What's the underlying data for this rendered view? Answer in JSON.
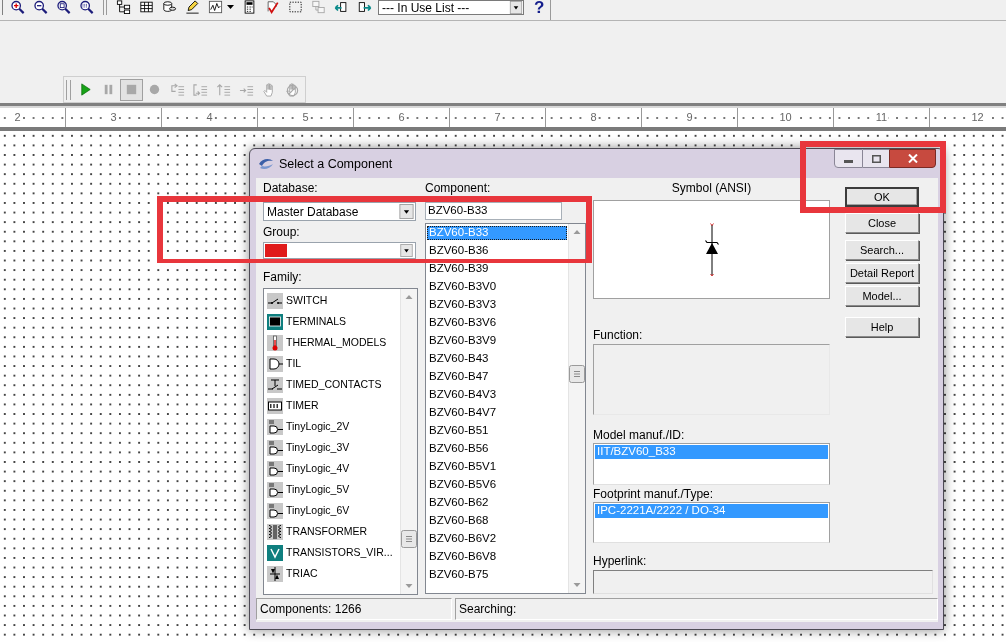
{
  "toolbar": {
    "tool_groups": [
      [
        {
          "kind": "zoomin",
          "disabled": false
        },
        {
          "kind": "zoomout",
          "disabled": false
        },
        {
          "kind": "zoomarea",
          "disabled": false
        },
        {
          "kind": "zoomfit",
          "disabled": false
        }
      ],
      [
        {
          "kind": "tree",
          "disabled": false
        },
        {
          "kind": "grid",
          "disabled": false
        },
        {
          "kind": "database",
          "disabled": false
        },
        {
          "kind": "pencil",
          "disabled": false
        },
        {
          "kind": "chart",
          "disabled": false
        },
        {
          "kind": "calculator",
          "disabled": false
        },
        {
          "kind": "check",
          "disabled": false
        },
        {
          "kind": "marquee",
          "disabled": false
        },
        {
          "kind": "copy",
          "disabled": true
        },
        {
          "kind": "back",
          "disabled": false
        },
        {
          "kind": "forward",
          "disabled": false
        }
      ]
    ],
    "list_dropdown": {
      "value": "--- In Use List ---"
    },
    "help": "?"
  },
  "simulation_toolbar": {
    "tools": [
      {
        "kind": "play",
        "disabled": false,
        "pressed": false
      },
      {
        "kind": "pause",
        "disabled": true,
        "pressed": false
      },
      {
        "kind": "stop",
        "disabled": true,
        "pressed": true
      },
      {
        "kind": "dot",
        "disabled": true,
        "pressed": false
      },
      {
        "kind": "loop",
        "disabled": true,
        "pressed": false
      },
      {
        "kind": "bracket",
        "disabled": true,
        "pressed": false
      },
      {
        "kind": "up",
        "disabled": true,
        "pressed": false
      },
      {
        "kind": "right",
        "disabled": true,
        "pressed": false
      },
      {
        "kind": "hand",
        "disabled": true,
        "pressed": false
      },
      {
        "kind": "handstop",
        "disabled": true,
        "pressed": false
      }
    ]
  },
  "ruler": {
    "marks": [
      "2",
      "3",
      "4",
      "5",
      "6",
      "7",
      "8",
      "9",
      "10",
      "11",
      "12"
    ]
  },
  "dialog": {
    "title": "Select a Component",
    "database": {
      "label": "Database:",
      "value": "Master Database"
    },
    "group": {
      "label": "Group:"
    },
    "family": {
      "label": "Family:",
      "items": [
        {
          "kind": "switch",
          "label": "SWITCH"
        },
        {
          "kind": "terminals",
          "label": "TERMINALS"
        },
        {
          "kind": "thermal",
          "label": "THERMAL_MODELS"
        },
        {
          "kind": "til",
          "label": "TIL"
        },
        {
          "kind": "timed",
          "label": "TIMED_CONTACTS"
        },
        {
          "kind": "timer",
          "label": "TIMER"
        },
        {
          "kind": "tinylogic",
          "label": "TinyLogic_2V"
        },
        {
          "kind": "tinylogic",
          "label": "TinyLogic_3V"
        },
        {
          "kind": "tinylogic",
          "label": "TinyLogic_4V"
        },
        {
          "kind": "tinylogic",
          "label": "TinyLogic_5V"
        },
        {
          "kind": "tinylogic",
          "label": "TinyLogic_6V"
        },
        {
          "kind": "transformer",
          "label": "TRANSFORMER"
        },
        {
          "kind": "transistor",
          "label": "TRANSISTORS_VIR..."
        },
        {
          "kind": "triac",
          "label": "TRIAC"
        }
      ]
    },
    "component": {
      "label": "Component:",
      "value": "BZV60-B33",
      "items": [
        {
          "label": "BZV60-B33",
          "selected": true
        },
        {
          "label": "BZV60-B36",
          "selected": false
        },
        {
          "label": "BZV60-B39",
          "selected": false
        },
        {
          "label": "BZV60-B3V0",
          "selected": false
        },
        {
          "label": "BZV60-B3V3",
          "selected": false
        },
        {
          "label": "BZV60-B3V6",
          "selected": false
        },
        {
          "label": "BZV60-B3V9",
          "selected": false
        },
        {
          "label": "BZV60-B43",
          "selected": false
        },
        {
          "label": "BZV60-B47",
          "selected": false
        },
        {
          "label": "BZV60-B4V3",
          "selected": false
        },
        {
          "label": "BZV60-B4V7",
          "selected": false
        },
        {
          "label": "BZV60-B51",
          "selected": false
        },
        {
          "label": "BZV60-B56",
          "selected": false
        },
        {
          "label": "BZV60-B5V1",
          "selected": false
        },
        {
          "label": "BZV60-B5V6",
          "selected": false
        },
        {
          "label": "BZV60-B62",
          "selected": false
        },
        {
          "label": "BZV60-B68",
          "selected": false
        },
        {
          "label": "BZV60-B6V2",
          "selected": false
        },
        {
          "label": "BZV60-B6V8",
          "selected": false
        },
        {
          "label": "BZV60-B75",
          "selected": false
        }
      ]
    },
    "symbol": {
      "label": "Symbol (ANSI)"
    },
    "function": {
      "label": "Function:"
    },
    "model": {
      "label": "Model manuf./ID:",
      "items": [
        {
          "label": "IIT/BZV60_B33",
          "selected": true
        }
      ]
    },
    "footprint": {
      "label": "Footprint manuf./Type:",
      "items": [
        {
          "label": "IPC-2221A/2222 / DO-34",
          "selected": true
        }
      ]
    },
    "hyperlink": {
      "label": "Hyperlink:"
    },
    "button_groups": [
      [
        {
          "label": "OK",
          "default": true
        },
        {
          "label": "Close",
          "default": false
        }
      ],
      [
        {
          "label": "Search...",
          "default": false
        },
        {
          "label": "Detail Report",
          "default": false
        },
        {
          "label": "Model...",
          "default": false
        }
      ],
      [
        {
          "label": "Help",
          "default": false
        }
      ]
    ],
    "status_bar": [
      "Components: 1266",
      "Searching:"
    ]
  },
  "highlight_frames": {
    "ok_button": true,
    "component_selection": true
  }
}
